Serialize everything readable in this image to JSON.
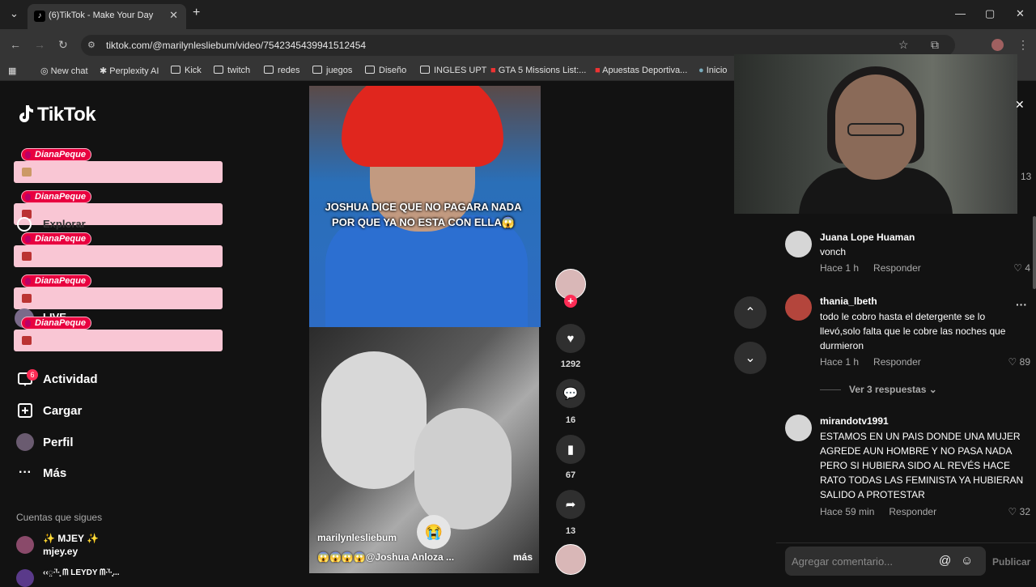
{
  "browser": {
    "tab_title": "(6)TikTok - Make Your Day",
    "url": "tiktok.com/@marilynlesliebum/video/7542345439941512454",
    "bookmarks": [
      {
        "label": "New chat",
        "icon": "openai-icon"
      },
      {
        "label": "Perplexity AI",
        "icon": "perplexity-icon"
      },
      {
        "label": "Kick",
        "icon": "folder-icon"
      },
      {
        "label": "twitch",
        "icon": "folder-icon"
      },
      {
        "label": "redes",
        "icon": "folder-icon"
      },
      {
        "label": "juegos",
        "icon": "folder-icon"
      },
      {
        "label": "Diseño",
        "icon": "folder-icon"
      },
      {
        "label": "INGLES UPT",
        "icon": "folder-icon"
      },
      {
        "label": "GTA 5 Missions List:...",
        "icon": "gta-icon"
      },
      {
        "label": "Apuestas Deportiva...",
        "icon": "bet-icon"
      },
      {
        "label": "Inicio",
        "icon": "inicio-icon"
      }
    ]
  },
  "sidebar": {
    "logo": "TikTok",
    "overlay_tag": "DianaPeque",
    "items": [
      {
        "label": "Actividad",
        "icon": "activity-icon",
        "badge": "6"
      },
      {
        "label": "Cargar",
        "icon": "upload-icon"
      },
      {
        "label": "Perfil",
        "icon": "profile-avatar"
      },
      {
        "label": "Más",
        "icon": "more-icon"
      }
    ],
    "partial_labels": [
      "Explorar",
      "LIVE"
    ],
    "following_title": "Cuentas que sigues",
    "following": [
      {
        "display": "✨ MJEY ✨",
        "handle": "mjey.ey"
      },
      {
        "display": "‹‹◌̤·̈ᵗ·̥̣ ᗰ LEYDY ᗰ·̈ᵗ·̥̣..."
      }
    ]
  },
  "video": {
    "caption": "JOSHUA DICE QUE NO PAGARA NADA POR QUE YA NO ESTA CON ELLA😱",
    "author": "marilynlesliebum",
    "description": "😱😱😱😱@Joshua Anloza ...",
    "more": "más"
  },
  "actions": {
    "likes": "1292",
    "comments": "16",
    "saves": "67",
    "shares": "13"
  },
  "comments_panel": {
    "partial_count": "13",
    "comments": [
      {
        "user": "Juana Lope Huaman",
        "text": "vonch",
        "time": "Hace 1 h",
        "reply": "Responder",
        "likes": "4"
      },
      {
        "user": "thania_lbeth",
        "text": "todo le cobro hasta el detergente se lo llevó,solo falta que le cobre las noches que durmieron",
        "time": "Hace 1 h",
        "reply": "Responder",
        "likes": "89"
      },
      {
        "user": "mirandotv1991",
        "text": "ESTAMOS EN UN PAIS DONDE UNA MUJER AGREDE AUN HOMBRE Y NO PASA NADA PERO SI HUBIERA SIDO AL REVÉS HACE RATO TODAS LAS FEMINISTA YA HUBIERAN SALIDO A PROTESTAR",
        "time": "Hace 59 min",
        "reply": "Responder",
        "likes": "32"
      }
    ],
    "view_replies": "Ver 3 respuestas",
    "input_placeholder": "Agregar comentario...",
    "publish": "Publicar"
  },
  "colors": {
    "accent": "#fe2c55",
    "overlay_pink": "#f9c6d4",
    "background": "#121212"
  }
}
